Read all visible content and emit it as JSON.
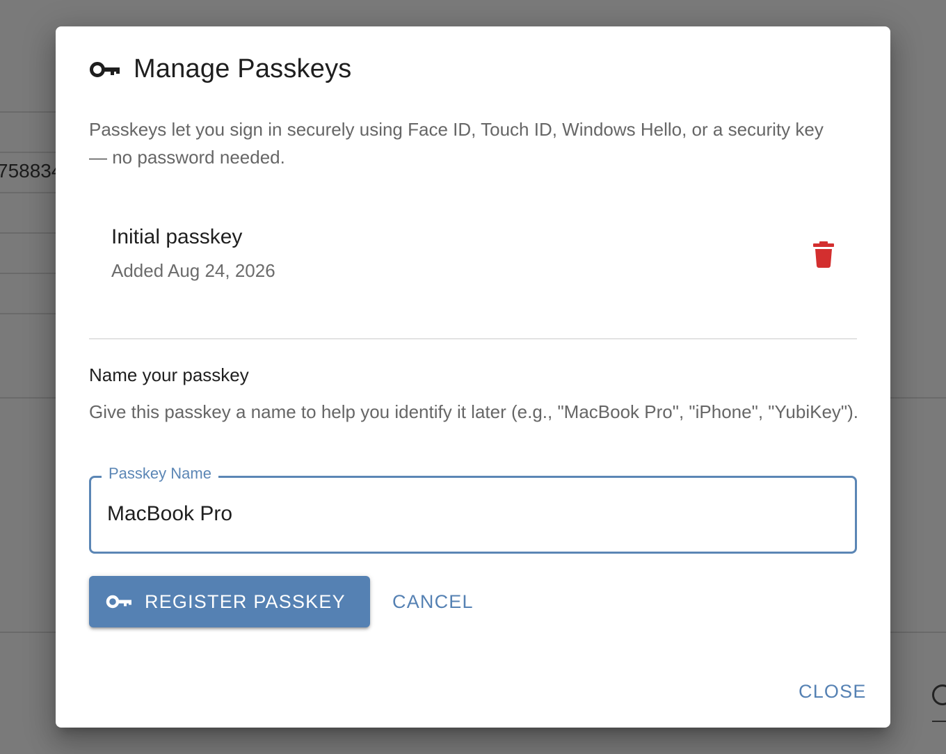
{
  "background": {
    "partial_text": "758834"
  },
  "dialog": {
    "title": "Manage Passkeys",
    "title_icon": "key-icon",
    "intro": "Passkeys let you sign in securely using Face ID, Touch ID, Windows Hello, or a security key — no password needed.",
    "passkeys": [
      {
        "name": "Initial passkey",
        "added": "Added Aug 24, 2026",
        "delete_icon": "trash-icon"
      }
    ],
    "name_section": {
      "title": "Name your passkey",
      "help": "Give this passkey a name to help you identify it later (e.g., \"MacBook Pro\", \"iPhone\", \"YubiKey\").",
      "field_label": "Passkey Name",
      "field_value": "MacBook Pro"
    },
    "actions": {
      "register_label": "REGISTER PASSKEY",
      "register_icon": "key-icon",
      "cancel_label": "CANCEL",
      "close_label": "CLOSE"
    }
  },
  "colors": {
    "primary": "#5581b3",
    "delete": "#d32f2f",
    "backdrop": "#7a7a7a"
  }
}
